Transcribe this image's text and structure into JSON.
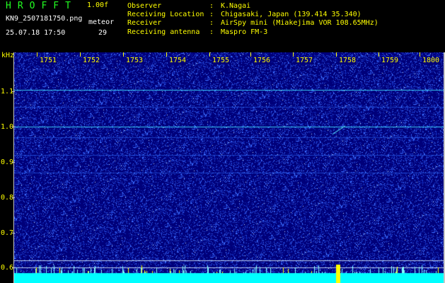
{
  "header": {
    "app_title": "HROFFT",
    "version": "1.00f",
    "filename": "KN9_2507181750.png",
    "meteor_label": "meteor",
    "datetime": "25.07.18 17:50",
    "meteor_count": "29"
  },
  "info": [
    {
      "key": "Observer",
      "value": "K.Nagai"
    },
    {
      "key": "Receiving Location",
      "value": "Chigasaki, Japan (139.414 35.340)"
    },
    {
      "key": "Receiver",
      "value": "AirSpy mini (Miakejima VOR 108.65MHz)"
    },
    {
      "key": "Receiving antenna",
      "value": "Maspro FM-3"
    }
  ],
  "chart_data": {
    "type": "heatmap",
    "y_unit": "kHz",
    "x_ticks": [
      "1751",
      "1752",
      "1753",
      "1754",
      "1755",
      "1756",
      "1757",
      "1758",
      "1759",
      "1800"
    ],
    "y_ticks": [
      "1.1",
      "1.0",
      "0.9",
      "0.8",
      "0.7",
      "0.6"
    ],
    "ylim": [
      0.58,
      1.13
    ],
    "xlim": [
      "1750",
      "1800"
    ],
    "background_color": "#00007a",
    "signal_color": "#00ffff",
    "horizontal_lines_khz": [
      1.105,
      1.055,
      1.0,
      0.97,
      0.92,
      0.87,
      0.62,
      0.6
    ],
    "meteor_trace": {
      "time": "17:57.9",
      "khz": 0.99
    }
  }
}
